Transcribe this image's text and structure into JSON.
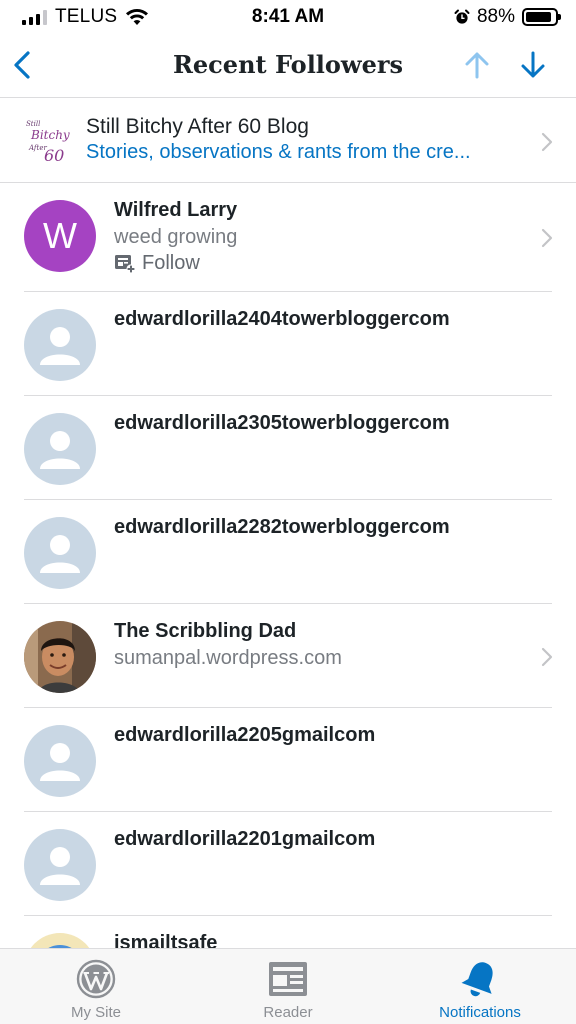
{
  "status_bar": {
    "carrier": "TELUS",
    "time": "8:41 AM",
    "battery_percent": "88%",
    "battery_level": 0.88,
    "signal_bars_active": 3
  },
  "nav": {
    "title": "Recent Followers",
    "back_icon": "chevron-left-icon",
    "prev_icon": "arrow-up-icon",
    "next_icon": "arrow-down-icon",
    "accent_color": "#0675c4",
    "disabled_color": "#8ec5ef"
  },
  "blog": {
    "name": "Still Bitchy After 60 Blog",
    "description": "Stories, observations & rants from the cre...",
    "logo_lines": [
      "Still",
      "Bitchy",
      "After",
      "60"
    ]
  },
  "followers": [
    {
      "name": "Wilfred Larry",
      "subtitle": "weed growing",
      "avatar_letter": "W",
      "avatar_color": "#a543c2",
      "action": "Follow"
    },
    {
      "name": "edwardlorilla2404towerbloggercom"
    },
    {
      "name": "edwardlorilla2305towerbloggercom"
    },
    {
      "name": "edwardlorilla2282towerbloggercom"
    },
    {
      "name": "The Scribbling Dad",
      "subtitle": "sumanpal.wordpress.com"
    },
    {
      "name": "edwardlorilla2205gmailcom"
    },
    {
      "name": "edwardlorilla2201gmailcom"
    },
    {
      "name": "ismailtsafe"
    }
  ],
  "tabs": [
    {
      "label": "My Site",
      "icon": "wordpress-icon",
      "active": false
    },
    {
      "label": "Reader",
      "icon": "reader-icon",
      "active": false
    },
    {
      "label": "Notifications",
      "icon": "bell-icon",
      "active": true
    }
  ]
}
